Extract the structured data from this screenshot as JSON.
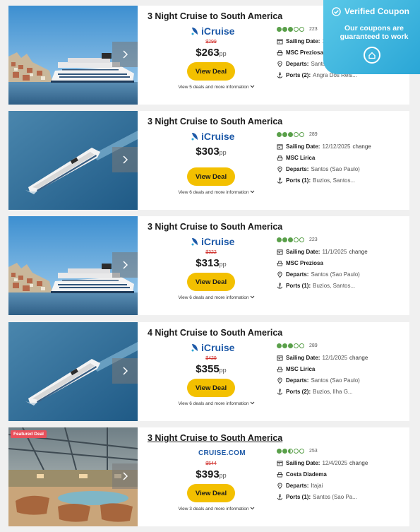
{
  "coupon": {
    "title": "Verified Coupon",
    "subtitle": "Our coupons are guaranteed to work"
  },
  "labels": {
    "view_deal": "View Deal",
    "sailing_date": "Sailing Date:",
    "departs": "Departs:"
  },
  "brands": {
    "icruise": "iCruise",
    "cruisecom": "CRUISE.COM"
  },
  "cards": [
    {
      "title": "3 Night Cruise to South America",
      "brand": "icruise",
      "old_price": "$299",
      "price": "$263",
      "pp": "pp",
      "more": "View 5 deals and more information",
      "rating_count": "223",
      "rating": 3,
      "sailing": "12/7/2025",
      "change": "change",
      "ship": "MSC Preziosa",
      "departs": "Santos (Sao Paulo)",
      "ports_label": "Ports (2):",
      "ports": "Angra Dos Reis...",
      "badge": "",
      "image": "ship-harbor"
    },
    {
      "title": "3 Night Cruise to South America",
      "brand": "icruise",
      "old_price": "",
      "price": "$303",
      "pp": "pp",
      "more": "View 6 deals and more information",
      "rating_count": "289",
      "rating": 3,
      "sailing": "12/12/2025",
      "change": "change",
      "ship": "MSC Lirica",
      "departs": "Santos (Sao Paulo)",
      "ports_label": "Ports (1):",
      "ports": "Buzios, Santos...",
      "badge": "",
      "image": "ship-sea"
    },
    {
      "title": "3 Night Cruise to South America",
      "brand": "icruise",
      "old_price": "$322",
      "price": "$313",
      "pp": "pp",
      "more": "View 6 deals and more information",
      "rating_count": "223",
      "rating": 3,
      "sailing": "11/1/2025",
      "change": "change",
      "ship": "MSC Preziosa",
      "departs": "Santos (Sao Paulo)",
      "ports_label": "Ports (1):",
      "ports": "Buzios, Santos...",
      "badge": "",
      "image": "ship-harbor"
    },
    {
      "title": "4 Night Cruise to South America",
      "brand": "icruise",
      "old_price": "$429",
      "price": "$355",
      "pp": "pp",
      "more": "View 6 deals and more information",
      "rating_count": "289",
      "rating": 3,
      "sailing": "12/1/2025",
      "change": "change",
      "ship": "MSC Lirica",
      "departs": "Santos (Sao Paulo)",
      "ports_label": "Ports (2):",
      "ports": "Buzios, Ilha G...",
      "badge": "",
      "image": "ship-sea"
    },
    {
      "title": "3 Night Cruise to South America",
      "brand": "cruisecom",
      "old_price": "$544",
      "price": "$393",
      "pp": "pp",
      "more": "View 3 deals and more information",
      "rating_count": "253",
      "rating": 2.5,
      "sailing": "12/4/2025",
      "change": "change",
      "ship": "Costa Diadema",
      "departs": "Itajai",
      "ports_label": "Ports (1):",
      "ports": "Santos (Sao Pa...",
      "badge": "Featured Deal",
      "image": "ship-deck"
    }
  ]
}
